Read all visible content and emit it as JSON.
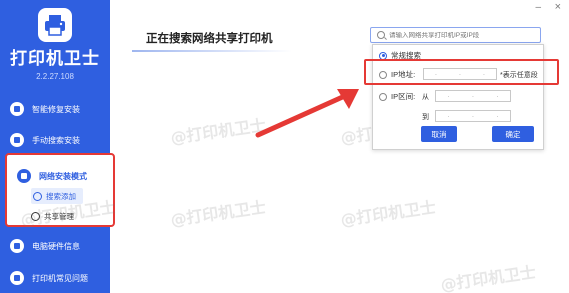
{
  "app": {
    "name": "打印机卫士",
    "version": "2.2.27.108",
    "accent": "#2f5fe0",
    "highlight": "#e53935"
  },
  "window": {
    "minimize_glyph": "–",
    "close_glyph": "×"
  },
  "sidebar": {
    "items": [
      {
        "label": "智能修复安装",
        "icon": "wrench-icon"
      },
      {
        "label": "手动搜索安装",
        "icon": "search-icon"
      },
      {
        "label": "网络安装模式",
        "icon": "network-icon"
      },
      {
        "label": "电脑硬件信息",
        "icon": "hardware-icon"
      },
      {
        "label": "打印机常见问题",
        "icon": "help-icon"
      }
    ],
    "sub_items": [
      {
        "label": "搜索添加",
        "icon": "search-add-icon"
      },
      {
        "label": "共享管理",
        "icon": "cloud-icon"
      }
    ]
  },
  "main": {
    "title": "正在搜索网络共享打印机",
    "watermark": "@打印机卫士"
  },
  "search": {
    "placeholder": "请输入网络共享打印机IP或IP段"
  },
  "panel": {
    "option_normal": "常规搜索",
    "option_ip": "IP地址:",
    "ip_hint": "*表示任意段",
    "option_range": "IP区间:",
    "range_from": "从",
    "range_to": "到",
    "cancel": "取消",
    "confirm": "确定"
  }
}
